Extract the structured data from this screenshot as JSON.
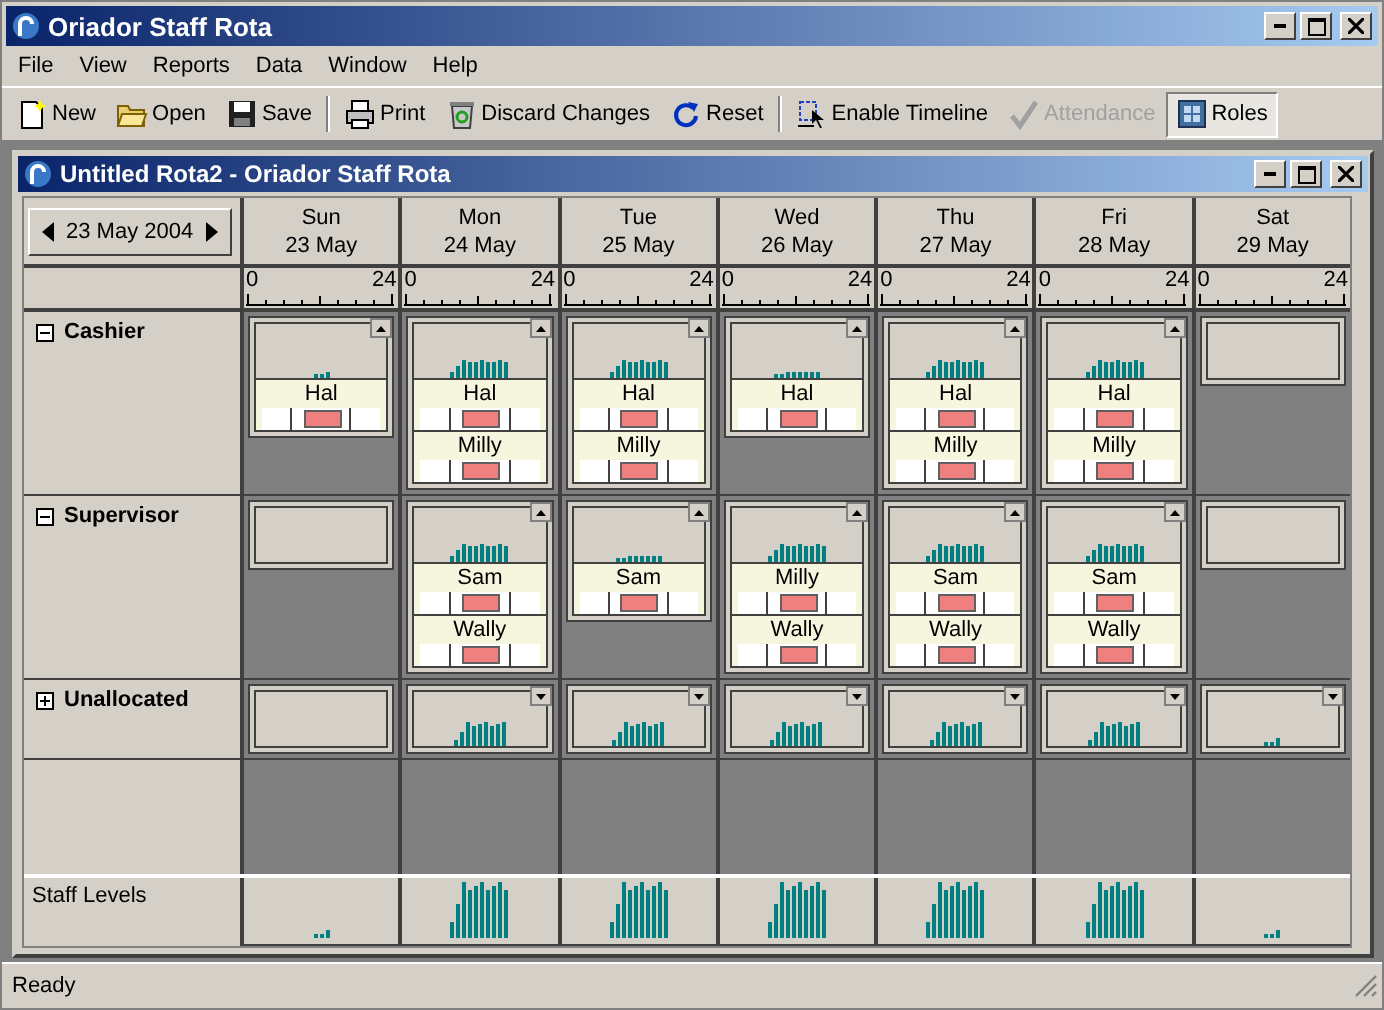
{
  "window": {
    "title": "Oriador Staff Rota"
  },
  "menu": [
    "File",
    "View",
    "Reports",
    "Data",
    "Window",
    "Help"
  ],
  "toolbar": [
    {
      "kind": "new",
      "label": "New",
      "disabled": false,
      "selected": false,
      "separator": false
    },
    {
      "kind": "open",
      "label": "Open",
      "disabled": false,
      "selected": false,
      "separator": false
    },
    {
      "kind": "save",
      "label": "Save",
      "disabled": false,
      "selected": false,
      "separator": true
    },
    {
      "kind": "print",
      "label": "Print",
      "disabled": false,
      "selected": false,
      "separator": false
    },
    {
      "kind": "discard",
      "label": "Discard Changes",
      "disabled": false,
      "selected": false,
      "separator": false
    },
    {
      "kind": "reset",
      "label": "Reset",
      "disabled": false,
      "selected": false,
      "separator": true
    },
    {
      "kind": "timeline",
      "label": "Enable Timeline",
      "disabled": false,
      "selected": false,
      "separator": false
    },
    {
      "kind": "attendance",
      "label": "Attendance",
      "disabled": true,
      "selected": false,
      "separator": false
    },
    {
      "kind": "roles",
      "label": "Roles",
      "disabled": false,
      "selected": true,
      "separator": false
    }
  ],
  "child": {
    "title": "Untitled Rota2 - Oriador Staff Rota",
    "date": "23 May 2004"
  },
  "days": [
    {
      "name": "Sun",
      "date": "23 May",
      "start": "0",
      "end": "24"
    },
    {
      "name": "Mon",
      "date": "24 May",
      "start": "0",
      "end": "24"
    },
    {
      "name": "Tue",
      "date": "25 May",
      "start": "0",
      "end": "24"
    },
    {
      "name": "Wed",
      "date": "26 May",
      "start": "0",
      "end": "24"
    },
    {
      "name": "Thu",
      "date": "27 May",
      "start": "0",
      "end": "24"
    },
    {
      "name": "Fri",
      "date": "28 May",
      "start": "0",
      "end": "24"
    },
    {
      "name": "Sat",
      "date": "29 May",
      "start": "0",
      "end": "24"
    }
  ],
  "roles": [
    {
      "name": "Cashier",
      "expanded": true,
      "cells": [
        {
          "kind": "roster",
          "shifts": [
            "Hal"
          ]
        },
        {
          "kind": "roster",
          "shifts": [
            "Hal",
            "Milly"
          ]
        },
        {
          "kind": "roster",
          "shifts": [
            "Hal",
            "Milly"
          ]
        },
        {
          "kind": "roster",
          "shifts": [
            "Hal"
          ]
        },
        {
          "kind": "roster",
          "shifts": [
            "Hal",
            "Milly"
          ]
        },
        {
          "kind": "roster",
          "shifts": [
            "Hal",
            "Milly"
          ]
        },
        {
          "kind": "blank"
        }
      ]
    },
    {
      "name": "Supervisor",
      "expanded": true,
      "cells": [
        {
          "kind": "blank"
        },
        {
          "kind": "roster",
          "shifts": [
            "Sam",
            "Wally"
          ]
        },
        {
          "kind": "roster",
          "shifts": [
            "Sam"
          ]
        },
        {
          "kind": "roster",
          "shifts": [
            "Milly",
            "Wally"
          ]
        },
        {
          "kind": "roster",
          "shifts": [
            "Sam",
            "Wally"
          ]
        },
        {
          "kind": "roster",
          "shifts": [
            "Sam",
            "Wally"
          ]
        },
        {
          "kind": "blank"
        }
      ]
    },
    {
      "name": "Unallocated",
      "expanded": false,
      "cells": [
        {
          "kind": "blank"
        },
        {
          "kind": "summary"
        },
        {
          "kind": "summary"
        },
        {
          "kind": "summary"
        },
        {
          "kind": "summary"
        },
        {
          "kind": "summary"
        },
        {
          "kind": "summary"
        }
      ]
    }
  ],
  "staff_levels": {
    "label": "Staff Levels"
  },
  "status_bar": {
    "text": "Ready"
  }
}
